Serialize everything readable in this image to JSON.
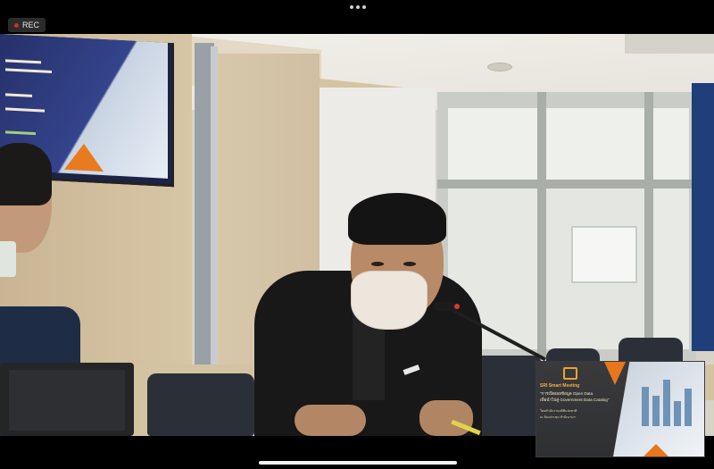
{
  "app": {
    "rec_label": "REC"
  },
  "presentation_slide": {
    "title_line": "SRI Smart Meeting",
    "subtitle_line1": "\"การเปิดเผยข้อมูล Open Data",
    "subtitle_line2": "เพื่อนำไปสู่ Government Data Catalog\"",
    "detail_line1": "โดยสำนักงานสถิติแห่งชาติ",
    "detail_line2": "ณ ห้องประชุม สำนักงานฯ"
  },
  "tv_slide": {
    "line1": "Catalog\"",
    "line2": "ข้อมูล",
    "line3": "ภาพรวม"
  },
  "icons": {
    "more": "more-dots-icon",
    "rec": "record-dot-icon"
  },
  "colors": {
    "rec_dot": "#c9302c",
    "accent_orange": "#e8761a",
    "blue_panel": "#1f3e7a"
  }
}
